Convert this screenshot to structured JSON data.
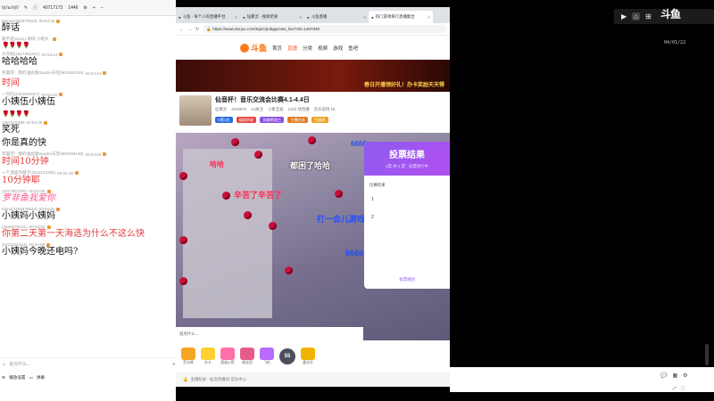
{
  "chat": {
    "topbar": {
      "handle": "\\(o'ω'o)\\/",
      "viewers": "40717173",
      "fans": "1446"
    },
    "messages": [
      {
        "name": "hainy(2282970824)",
        "time": "00:54:42",
        "text": "醉话",
        "style": "black"
      },
      {
        "name": "越不是(2131) 进场 小桃头",
        "time": "",
        "text": "",
        "style": "roses"
      },
      {
        "name": "大月初(1917384221)",
        "time": "00:54:44",
        "text": "哈哈哈哈",
        "style": "black"
      },
      {
        "name": "罗蕾莎：我的油豆腐Spader天空(900489148)",
        "time": "00:54:44",
        "text": "",
        "style": "system"
      },
      {
        "name": "",
        "time": "",
        "text": "时间",
        "style": "red"
      },
      {
        "name": "一月的(2191092027)",
        "time": "00:54:45",
        "text": "小姨伍小姨伍",
        "style": "black"
      },
      {
        "name": "",
        "time": "",
        "text": "",
        "style": "roses"
      },
      {
        "name": "1381575399",
        "time": "00:54:46",
        "text": "笑死",
        "style": "black"
      },
      {
        "name": "",
        "time": "",
        "text": "你是真的快",
        "style": "black"
      },
      {
        "name": "罗蕾莎：我的油豆腐Spader天空(900489148)",
        "time": "00:54:49",
        "text": "时间10分钟",
        "style": "red"
      },
      {
        "name": "一个温柔的橙子(2511142282)",
        "time": "00:54:49",
        "text": "10分钟耶",
        "style": "red"
      },
      {
        "name": "(2017667282)",
        "time": "00:54:50",
        "text": "罗非鱼我爱你",
        "style": "pink"
      },
      {
        "name": "hainy(2282970824)",
        "time": "00:54:52",
        "text": "小姨妈小姨妈",
        "style": "black"
      },
      {
        "name": "(2646279141)",
        "time": "00:54:54",
        "text": "你第二天第一天海选为什么不这么快",
        "style": "red"
      },
      {
        "name": "(2421101613)",
        "time": "00:54:58",
        "text": "小姨妈今晚还电吗?",
        "style": "black"
      }
    ],
    "input": {
      "placeholder": "说点什么..."
    },
    "bottom": {
      "label1": "播放设置",
      "label2": "弹幕"
    }
  },
  "browser": {
    "tabs": [
      {
        "label": "斗鱼 - 每个人的直播平台"
      },
      {
        "label": "仙雾灵 - 搜索结果"
      },
      {
        "label": "斗鱼直播"
      },
      {
        "label": "热门游戏排行直播集合"
      }
    ],
    "url": "https://www.douyu.com/topic/pubgqrnew_live?rid=1457640",
    "site": {
      "nav": [
        "首页",
        "直播",
        "分类",
        "视频",
        "游戏",
        "鱼吧"
      ],
      "banner_text": "春日开播领好礼！办卡奖励天天得"
    },
    "room": {
      "title": "仙音杯！音乐交流会比赛4.1-4.4日",
      "meta": [
        "仙雾灵",
        "4236870",
        "14关注",
        "小象互娱",
        "1232 场直播",
        "音乐现场 18"
      ],
      "badges": [
        "V第1名",
        "福袋四轮",
        "贡献榜前三",
        "主播任务",
        "扫描机"
      ]
    },
    "player": {
      "bullets": [
        {
          "text": "哈哈",
          "cls": "b-red"
        },
        {
          "text": "都困了哈哈",
          "cls": "b-white"
        },
        {
          "text": "辛苦了辛苦了",
          "cls": "b-red"
        },
        {
          "text": "打一会儿游戏",
          "cls": "b-blue"
        },
        {
          "text": "6666",
          "cls": "b-blue"
        },
        {
          "text": "6666",
          "cls": "b-blue"
        }
      ],
      "vote": {
        "title": "投票结果",
        "subtitle": "1票·共 2 票 · 投票进行中",
        "label": "比赛结果",
        "options": [
          "1",
          "2"
        ],
        "link": "投票规则"
      },
      "bar_text": "说点什么..."
    },
    "gifts": [
      "荧光棒",
      "办卡",
      "超级火箭",
      "粉丝团",
      "飞机",
      "嘉年华"
    ],
    "level": "55",
    "status_text": "主播纪录 · 仙音直播间·音乐中心"
  },
  "right": {
    "logo": "斗鱼",
    "date_text": "04/01/22",
    "bottom_icons": [
      "chat",
      "grid",
      "settings"
    ]
  }
}
